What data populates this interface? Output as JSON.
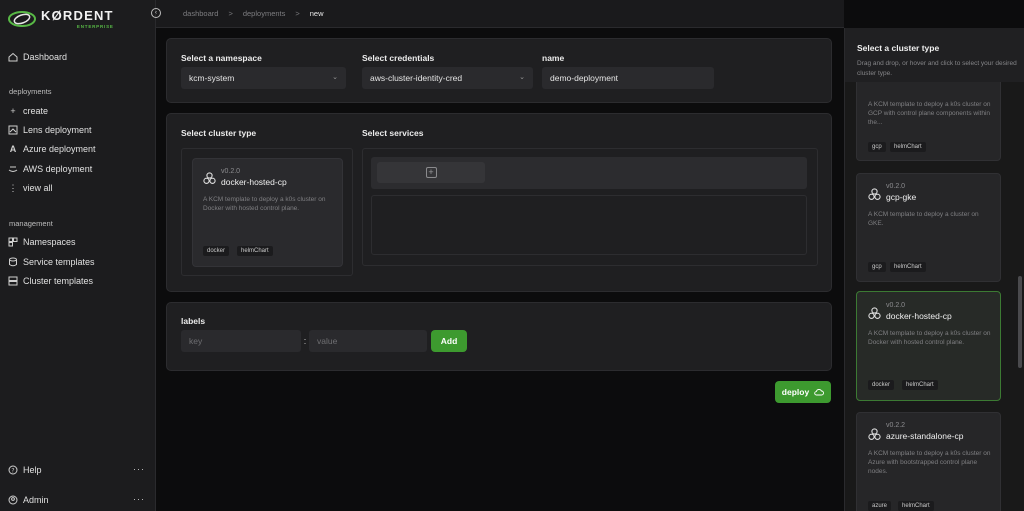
{
  "brand": {
    "name": "KØRDENT",
    "sub": "ENTERPRISE"
  },
  "sidebar": {
    "dashboard": "Dashboard",
    "deployments_title": "deployments",
    "deployments": [
      "create",
      "Lens deployment",
      "Azure deployment",
      "AWS deployment",
      "view all"
    ],
    "management_title": "management",
    "management": [
      "Namespaces",
      "Service templates",
      "Cluster templates"
    ],
    "help": "Help",
    "admin": "Admin",
    "more": "···"
  },
  "breadcrumb": {
    "items": [
      "dashboard",
      "deployments",
      "new"
    ],
    "sep": ">"
  },
  "form": {
    "namespace_label": "Select a namespace",
    "namespace_value": "kcm-system",
    "credentials_label": "Select credentials",
    "credentials_value": "aws-cluster-identity-cred",
    "name_label": "name",
    "name_value": "demo-deployment",
    "cluster_type_label": "Select cluster type",
    "services_label": "Select services",
    "add_service_icon": "+",
    "selected_card": {
      "version": "v0.2.0",
      "title": "docker-hosted-cp",
      "desc": "A KCM template to deploy a k0s cluster on Docker with hosted control plane.",
      "tags": [
        "docker",
        "helmChart"
      ]
    },
    "labels_title": "labels",
    "key_placeholder": "key",
    "value_placeholder": "value",
    "kv_sep": ":",
    "add_label": "Add",
    "deploy_label": "deploy"
  },
  "cluster_panel": {
    "title": "Select a cluster type",
    "subtitle": "Drag and drop, or hover and click to select your desired cluster type.",
    "cards": [
      {
        "version": "",
        "title": "",
        "desc": "A KCM template to deploy a k0s cluster on GCP with control plane components within the...",
        "tags": [
          "gcp",
          "helmChart"
        ]
      },
      {
        "version": "v0.2.0",
        "title": "gcp-gke",
        "desc": "A KCM template to deploy a cluster on GKE.",
        "tags": [
          "gcp",
          "helmChart"
        ]
      },
      {
        "version": "v0.2.0",
        "title": "docker-hosted-cp",
        "desc": "A KCM template to deploy a k0s cluster on Docker with hosted control plane.",
        "tags": [
          "docker",
          "helmChart"
        ]
      },
      {
        "version": "v0.2.2",
        "title": "azure-standalone-cp",
        "desc": "A KCM template to deploy a k0s cluster on Azure with bootstrapped control plane nodes.",
        "tags": [
          "azure",
          "helmChart"
        ]
      }
    ]
  },
  "colors": {
    "accent": "#3d9a2f",
    "brand_green": "#58b946"
  }
}
